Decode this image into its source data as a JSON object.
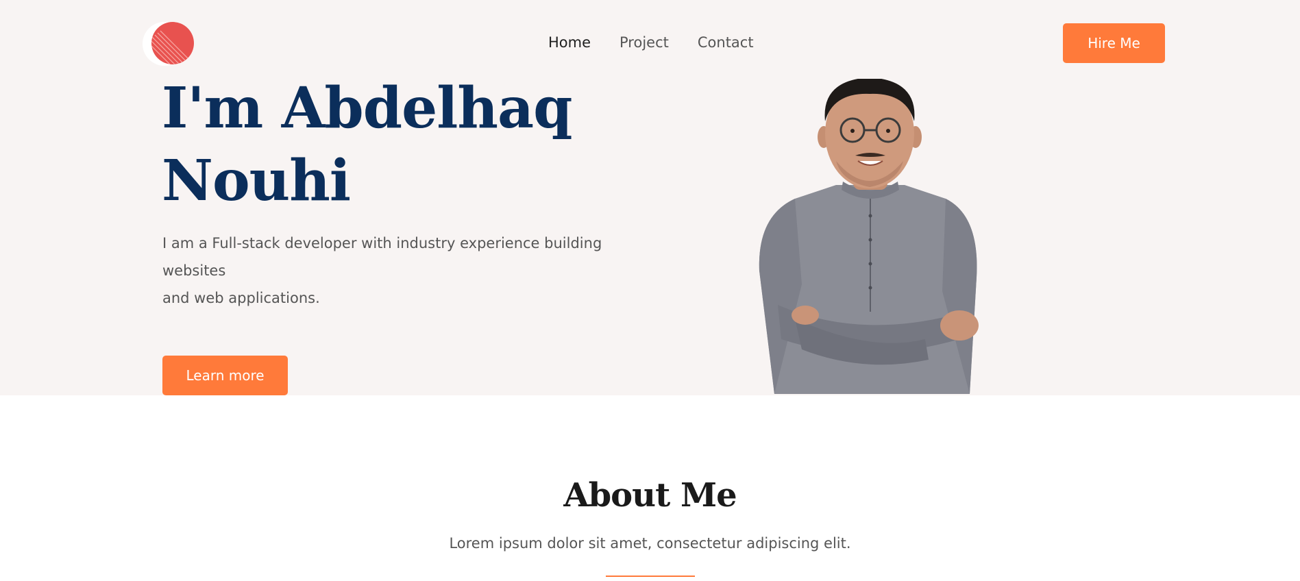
{
  "colors": {
    "accent": "#ff7a3a",
    "hero_bg": "#f8f4f3",
    "headline": "#0b2e5b",
    "logo": "#e8524f"
  },
  "nav": {
    "items": [
      {
        "label": "Home",
        "active": true
      },
      {
        "label": "Project",
        "active": false
      },
      {
        "label": "Contact",
        "active": false
      }
    ],
    "cta_label": "Hire Me"
  },
  "hero": {
    "headline_line1": "I'm Abdelhaq",
    "headline_line2": "Nouhi",
    "intro_line1": "I am a Full-stack developer with industry experience building websites",
    "intro_line2": "and web applications.",
    "button_label": "Learn more"
  },
  "about": {
    "title": "About Me",
    "text": "Lorem ipsum dolor sit amet, consectetur adipiscing elit."
  }
}
